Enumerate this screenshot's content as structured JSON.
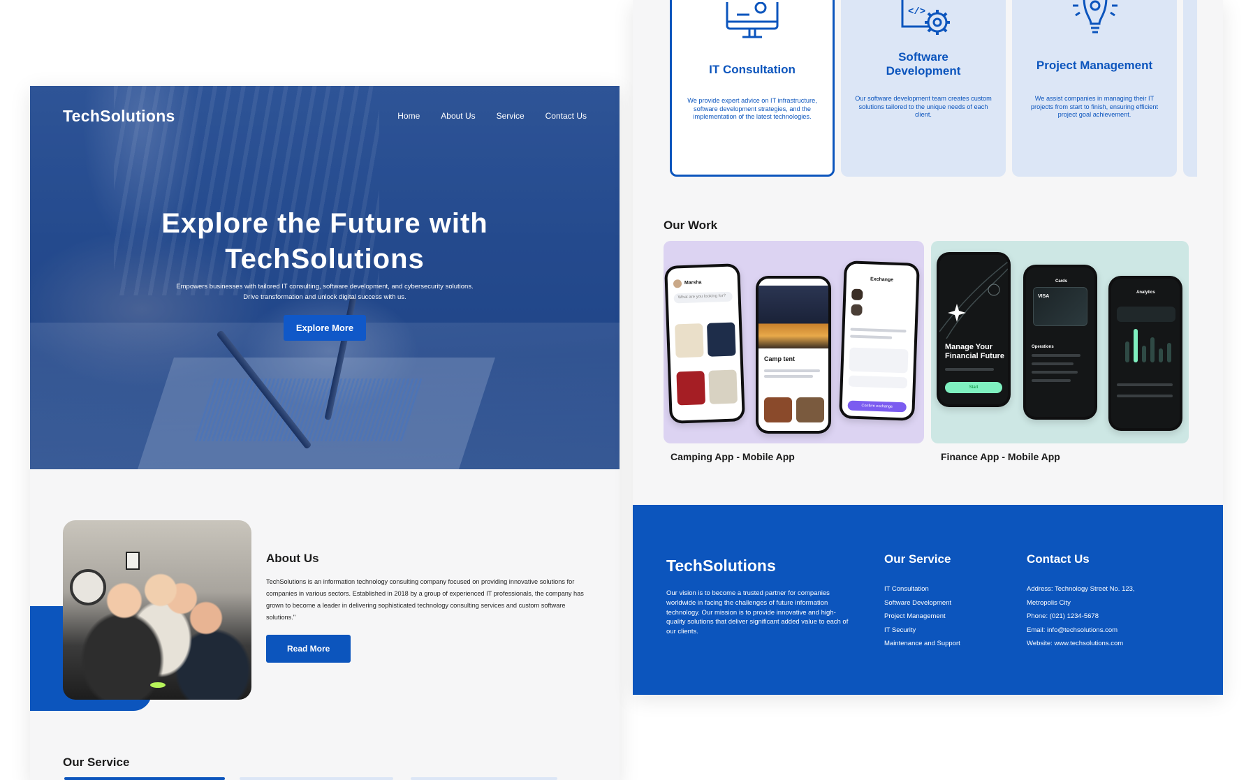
{
  "left": {
    "nav": {
      "logo": "TechSolutions",
      "links": [
        "Home",
        "About Us",
        "Service",
        "Contact Us"
      ]
    },
    "hero": {
      "title_line1": "Explore the Future with",
      "title_line2": "TechSolutions",
      "subtitle_line1": "Empowers businesses with tailored IT consulting, software development, and cybersecurity solutions.",
      "subtitle_line2": "Drive transformation and unlock digital success with us.",
      "cta": "Explore More"
    },
    "about": {
      "title": "About Us",
      "body": "TechSolutions is an information technology consulting company focused on providing innovative solutions for companies in various sectors. Established in 2018 by a group of experienced IT professionals, the company has grown to become a leader in delivering sophisticated technology consulting services and custom software solutions.\"",
      "cta": "Read More"
    },
    "service_title": "Our Service"
  },
  "right": {
    "services": [
      {
        "title": "IT Consultation",
        "desc": "We provide expert advice on IT infrastructure, software development strategies, and the implementation of the latest technologies.",
        "icon": "monitor-gear-icon"
      },
      {
        "title_line1": "Software",
        "title_line2": "Development",
        "desc": "Our software development team creates custom solutions tailored to the unique needs of each client.",
        "icon": "code-gear-icon"
      },
      {
        "title": "Project Management",
        "desc": "We assist companies in managing their IT projects from start to finish, ensuring efficient project goal achievement.",
        "icon": "lightbulb-gear-icon"
      }
    ],
    "work": {
      "title": "Our Work",
      "items": [
        {
          "label": "Camping App - Mobile App",
          "bg": "#dcd3f2"
        },
        {
          "label": "Finance App - Mobile App",
          "bg": "#cde7e4"
        }
      ],
      "camping_screens": {
        "greeting": "Marsha",
        "search": "What are you looking for?",
        "product": "Camp tent",
        "exchange": "Exchange",
        "confirm": "Confirm exchange"
      },
      "finance_screens": {
        "headline": "Manage Your Financial Future",
        "start": "Start",
        "cards": "Cards",
        "visa": "VISA",
        "operations": "Operations",
        "analytics": "Analytics"
      }
    },
    "footer": {
      "logo": "TechSolutions",
      "desc": "Our vision is to become a trusted partner for companies worldwide in facing the challenges of future information technology. Our mission is to provide innovative and high-quality solutions that deliver significant added value to each of our clients.",
      "service_title": "Our Service",
      "services": [
        "IT Consultation",
        "Software Development",
        "Project Management",
        "IT Security",
        "Maintenance and Support"
      ],
      "contact_title": "Contact Us",
      "address_line1": "Address: Technology Street No. 123,",
      "address_line2": "Metropolis City",
      "phone": "Phone: (021) 1234-5678",
      "email": "Email: info@techsolutions.com",
      "website_label": "Website: ",
      "website_link": "www.techsolutions.com"
    }
  },
  "colors": {
    "brand_blue": "#0c55bd",
    "card_bg": "#dce6f6",
    "page_bg": "#f6f6f7"
  }
}
